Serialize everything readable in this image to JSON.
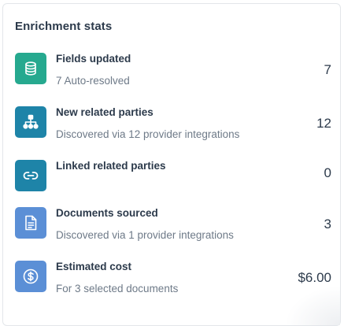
{
  "card": {
    "title": "Enrichment stats"
  },
  "stats": [
    {
      "label": "Fields updated",
      "sub": "7 Auto-resolved",
      "value": "7",
      "icon": "database-icon",
      "color": "#26a98f"
    },
    {
      "label": "New related parties",
      "sub": "Discovered via 12 provider integrations",
      "value": "12",
      "icon": "org-chart-icon",
      "color": "#1e84a8"
    },
    {
      "label": "Linked related parties",
      "sub": "",
      "value": "0",
      "icon": "link-icon",
      "color": "#1e84a8"
    },
    {
      "label": "Documents sourced",
      "sub": "Discovered via 1 provider integrations",
      "value": "3",
      "icon": "document-icon",
      "color": "#5b8fd6"
    },
    {
      "label": "Estimated cost",
      "sub": "For 3 selected documents",
      "value": "$6.00",
      "icon": "dollar-circle-icon",
      "color": "#5b8fd6"
    }
  ]
}
